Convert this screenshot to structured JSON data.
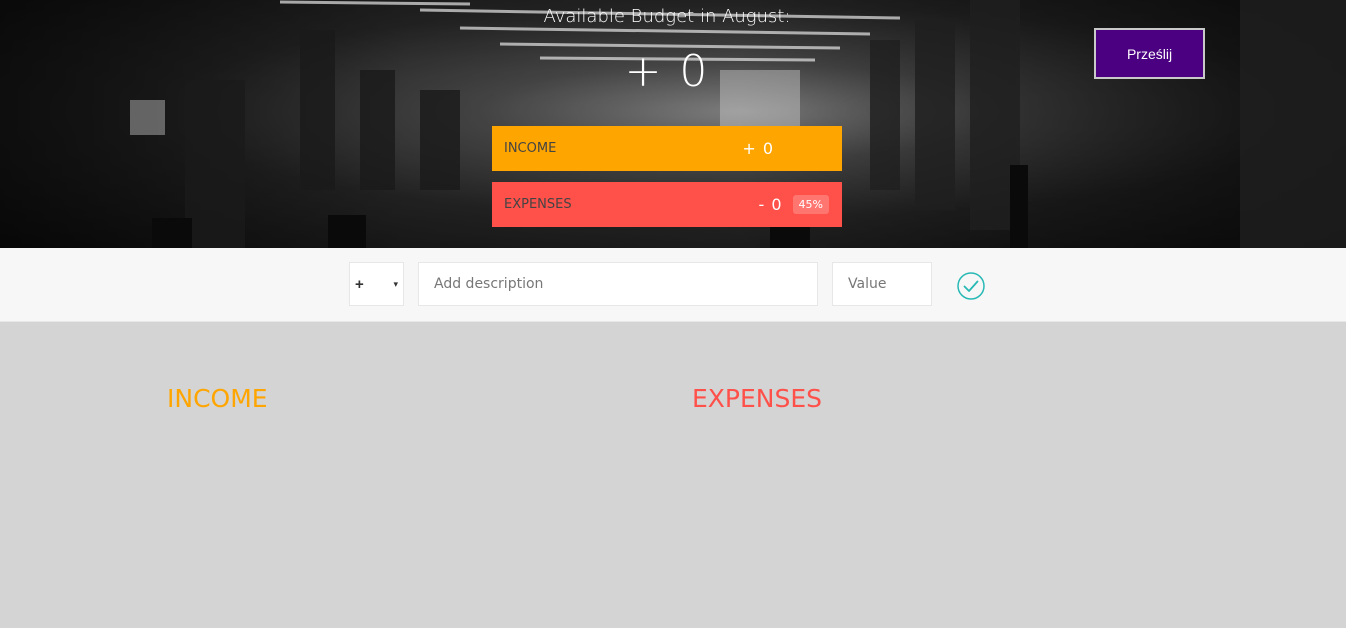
{
  "budget": {
    "title": "Available Budget in August:",
    "value": "+ 0"
  },
  "summary": {
    "income": {
      "label": "INCOME",
      "value": "+ 0"
    },
    "expenses": {
      "label": "EXPENSES",
      "value": "- 0",
      "percentage": "45%"
    }
  },
  "submit_button": {
    "label": "Prześlij"
  },
  "add_form": {
    "type_selected": "+",
    "type_arrow": "▾",
    "description_placeholder": "Add description",
    "value_placeholder": "Value",
    "confirm_icon": "check-circle-icon"
  },
  "lists": {
    "income_title": "INCOME",
    "expenses_title": "EXPENSES"
  },
  "colors": {
    "income": "#ffa500",
    "expenses": "#ff5049",
    "submit": "#4b0082",
    "confirm": "#28b9b5"
  }
}
